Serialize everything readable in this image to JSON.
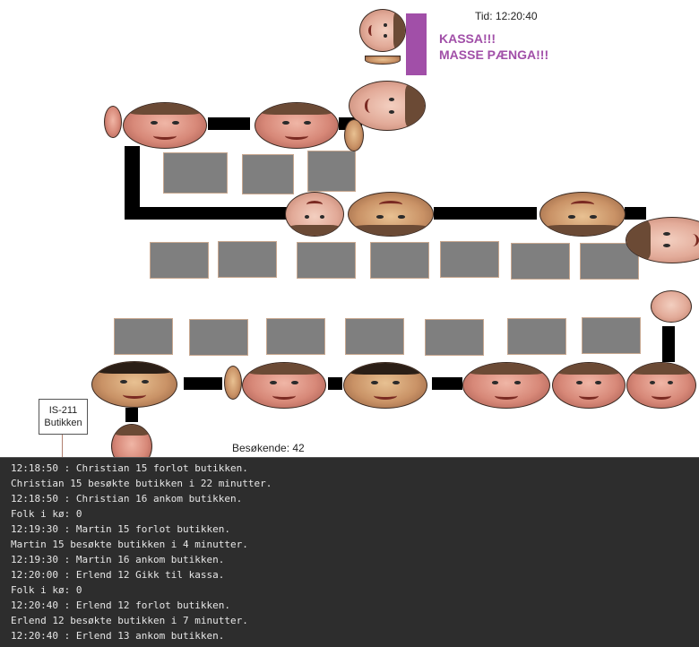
{
  "clock_label": "Tid: 12:20:40",
  "kassa_text": "KASSA!!!\nMASSE PÆNGA!!!",
  "store_label_line1": "IS-211",
  "store_label_line2": "Butikken",
  "visitors_label": "Besøkende: 42",
  "colors": {
    "kassa": "#a14fa8",
    "shelf": "#7f7f7f",
    "path": "#000000",
    "log_bg": "#2d2d2d"
  },
  "log_lines": [
    "12:18:50 : Christian 15 forlot butikken.",
    "Christian 15 besøkte butikken i 22 minutter.",
    "12:18:50 : Christian 16 ankom butikken.",
    "Folk i kø: 0",
    "12:19:30 : Martin 15 forlot butikken.",
    "Martin 15 besøkte butikken i 4 minutter.",
    "12:19:30 : Martin 16 ankom butikken.",
    "12:20:00 : Erlend 12 Gikk til kassa.",
    "Folk i kø: 0",
    "12:20:40 : Erlend 12 forlot butikken.",
    "Erlend 12 besøkte butikken i 7 minutter.",
    "12:20:40 : Erlend 13 ankom butikken."
  ]
}
